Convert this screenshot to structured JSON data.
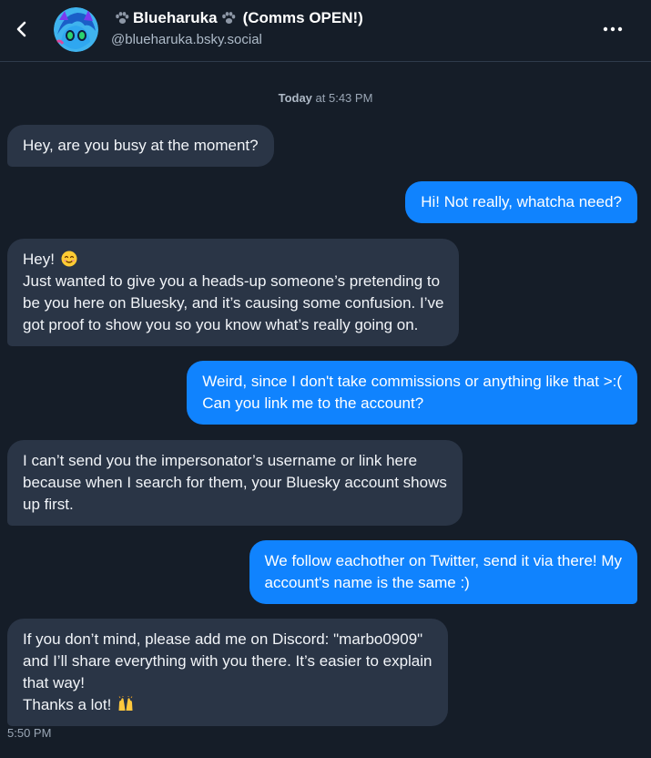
{
  "header": {
    "display_name": "Blueharuka",
    "display_name_suffix": "(Comms OPEN!)",
    "handle": "@blueharuka.bsky.social",
    "back_icon": "chevron-left-icon",
    "more_icon": "more-horizontal-icon",
    "paw_icon": "paw-print-icon"
  },
  "date_separator": {
    "day": "Today",
    "rest": " at 5:43 PM"
  },
  "messages": [
    {
      "direction": "incoming",
      "lines": [
        "Hey, are you busy at the moment?"
      ]
    },
    {
      "direction": "outgoing",
      "lines": [
        "Hi! Not really, whatcha need?"
      ]
    },
    {
      "direction": "incoming",
      "lines": [
        "Hey!",
        "Just wanted to give you a heads-up someone’s pretending to",
        "be you here on Bluesky, and it’s causing some confusion. I’ve",
        "got proof to show you so you know what’s really going on."
      ],
      "emoji": "smiling-face-emoji"
    },
    {
      "direction": "outgoing",
      "lines": [
        "Weird, since I don't take commissions or anything like that >:(",
        "Can you link me to the account?"
      ]
    },
    {
      "direction": "incoming",
      "lines": [
        "I can’t send you the impersonator’s username or link here",
        "because when I search for them, your Bluesky account shows",
        "up first."
      ]
    },
    {
      "direction": "outgoing",
      "lines": [
        "We follow eachother on Twitter, send it via there! My",
        "account's name is the same :)"
      ]
    },
    {
      "direction": "incoming",
      "lines": [
        "If you don’t mind, please add me on Discord: \"marbo0909\"",
        "and I’ll share everything with you there. It’s easier to explain",
        "that way!",
        "Thanks a lot!"
      ],
      "emoji": "raising-hands-emoji"
    }
  ],
  "last_message_time": "5:50 PM",
  "colors": {
    "background": "#151d28",
    "incoming_bubble": "#2a3546",
    "outgoing_bubble": "#1083fe",
    "muted_text": "#aebbc9"
  }
}
